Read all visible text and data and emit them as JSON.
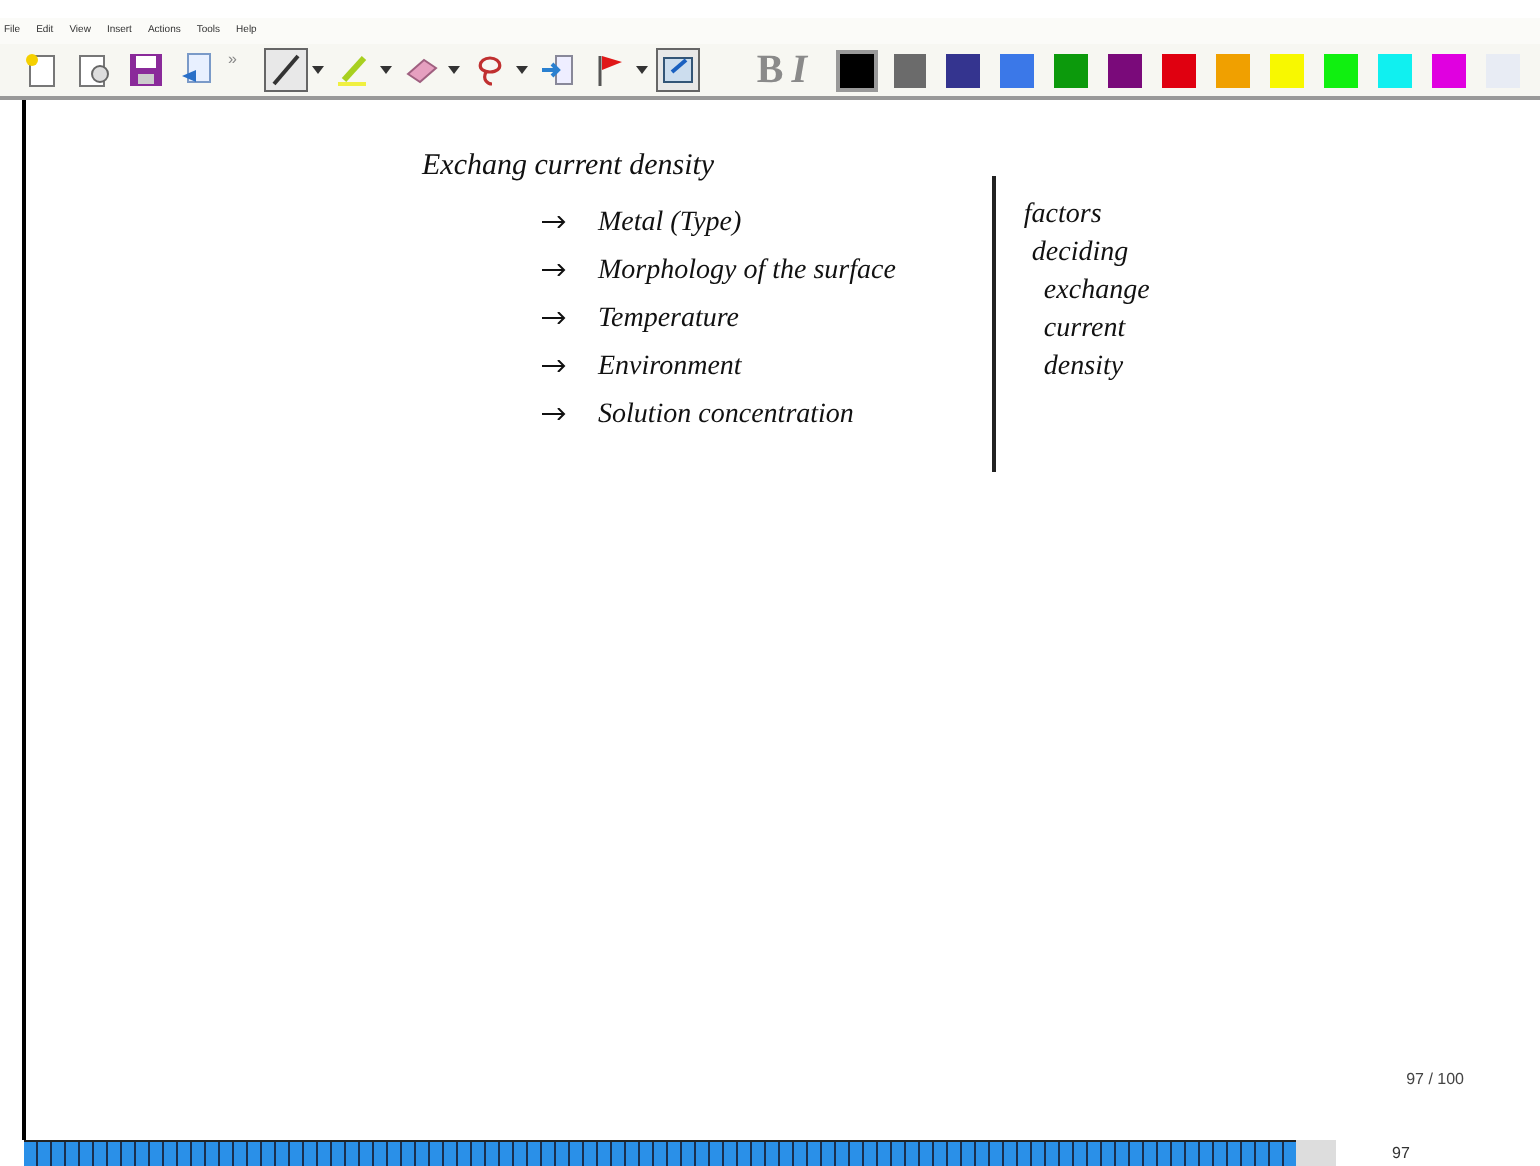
{
  "menu": [
    "File",
    "Edit",
    "View",
    "Insert",
    "Actions",
    "Tools",
    "Help"
  ],
  "toolbar": {
    "overflow": "»",
    "tools": [
      {
        "kind": "new",
        "selected": false
      },
      {
        "kind": "template",
        "selected": false
      },
      {
        "kind": "save",
        "selected": false
      },
      {
        "kind": "email",
        "selected": false
      },
      {
        "kind": "pen",
        "selected": true
      },
      {
        "kind": "highlighter",
        "selected": false
      },
      {
        "kind": "eraser",
        "selected": false
      },
      {
        "kind": "lasso",
        "selected": false
      },
      {
        "kind": "space",
        "selected": false
      },
      {
        "kind": "flag",
        "selected": false
      },
      {
        "kind": "view",
        "selected": true
      }
    ],
    "format": [
      "B",
      "I"
    ],
    "colors": [
      {
        "color": "#000000",
        "selected": true
      },
      {
        "color": "#6b6b6b",
        "selected": false
      },
      {
        "color": "#34348f",
        "selected": false
      },
      {
        "color": "#3b78e8",
        "selected": false
      },
      {
        "color": "#0c9a0c",
        "selected": false
      },
      {
        "color": "#7a0a7a",
        "selected": false
      },
      {
        "color": "#e00010",
        "selected": false
      },
      {
        "color": "#f0a000",
        "selected": false
      },
      {
        "color": "#f8f800",
        "selected": false
      },
      {
        "color": "#10f010",
        "selected": false
      },
      {
        "color": "#10f0f0",
        "selected": false
      },
      {
        "color": "#e000e0",
        "selected": false
      },
      {
        "color": "#e8ecf4",
        "selected": false
      }
    ]
  },
  "note": {
    "heading": "Exchang current density",
    "items": [
      "Metal (Type)",
      "Morphology of the surface",
      "Temperature",
      "Environment",
      "Solution concentration"
    ],
    "side": [
      "factors",
      "deciding",
      "exchange",
      "current",
      "density"
    ]
  },
  "page_counter": "97 / 100",
  "page_bar": {
    "current": "97",
    "level": 0.97
  }
}
